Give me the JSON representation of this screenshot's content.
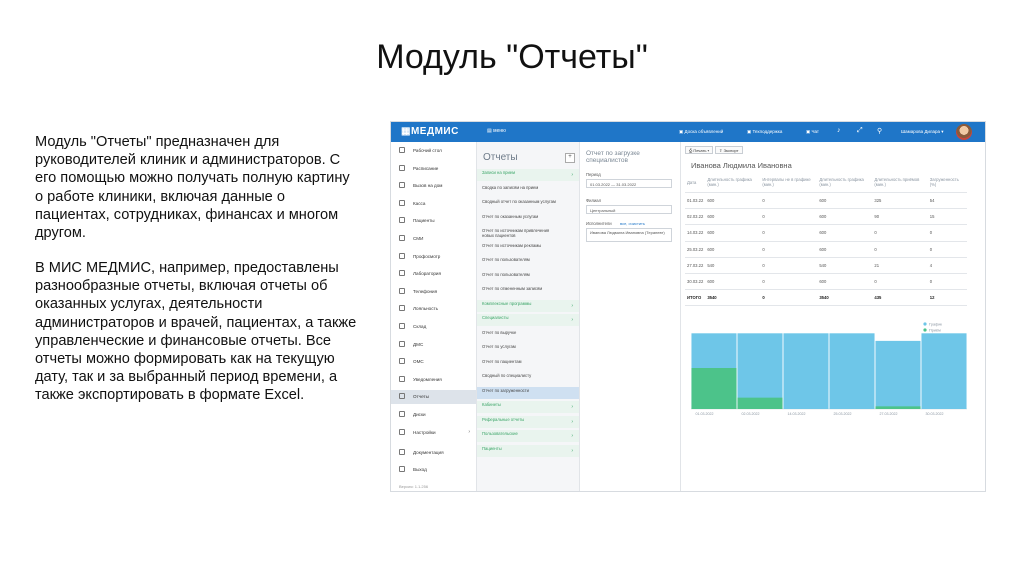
{
  "slide": {
    "title": "Модуль \"Отчеты\"",
    "paragraph1": "Модуль \"Отчеты\" предназначен для руководителей клиник и администраторов. С его помощью можно получать полную картину о работе клиники, включая данные о пациентах, сотрудниках, финансах и многом другом.",
    "paragraph2": "В МИС МЕДМИС, например, предоставлены разнообразные отчеты, включая отчеты об оказанных услугах, деятельности администраторов и врачей, пациентах, а также управленческие и финансовые отчеты. Все отчеты можно формировать как на текущую дату, так и за выбранный период времени, а также экспортировать в формате Excel."
  },
  "app": {
    "logo": "МЕДМИС",
    "menu_label": "меню",
    "topbar_items": [
      "Доска объявлений",
      "Техподдержка",
      "Чат"
    ],
    "user_name": "Шамарова Дилара",
    "accent_color": "#1f76c8",
    "sidebar": [
      {
        "label": "Рабочий стол",
        "icon": "desktop-icon"
      },
      {
        "label": "Расписание",
        "icon": "calendar-icon"
      },
      {
        "label": "Вызов на дом",
        "icon": "home-icon"
      },
      {
        "label": "Касса",
        "icon": "cash-icon"
      },
      {
        "label": "Пациенты",
        "icon": "patients-icon"
      },
      {
        "label": "СМИ",
        "icon": "media-icon"
      },
      {
        "label": "Профосмотр",
        "icon": "checkup-icon"
      },
      {
        "label": "Лаборатория",
        "icon": "lab-icon"
      },
      {
        "label": "Телефония",
        "icon": "phone-icon"
      },
      {
        "label": "Лояльность",
        "icon": "loyalty-icon"
      },
      {
        "label": "Склад",
        "icon": "warehouse-icon"
      },
      {
        "label": "ДМС",
        "icon": "insurance-icon"
      },
      {
        "label": "ОМС",
        "icon": "insurance-icon"
      },
      {
        "label": "Уведомления",
        "icon": "bell-icon"
      },
      {
        "label": "Отчеты",
        "icon": "reports-icon",
        "active": true
      },
      {
        "label": "Диски",
        "icon": "disk-icon"
      },
      {
        "label": "Настройки",
        "icon": "gear-icon"
      }
    ],
    "sidebar_bottom": [
      {
        "label": "Документация",
        "icon": "document-icon"
      },
      {
        "label": "Выход",
        "icon": "logout-icon"
      }
    ],
    "version": "Версия: 1.1.256",
    "reports_panel": {
      "title": "Отчеты",
      "items": [
        {
          "label": "Записи на прием",
          "group": true
        },
        {
          "label": "Сводка по записям на прием"
        },
        {
          "label": "Сводный отчет по оказанным услугам"
        },
        {
          "label": "Отчет по оказанным услугам"
        },
        {
          "label": "Отчет по источникам привлечения новых пациентов"
        },
        {
          "label": "Отчет по источникам рекламы"
        },
        {
          "label": "Отчет по пользователям"
        },
        {
          "label": "Отчет по пользователям"
        },
        {
          "label": "Отчет по отмененным записям"
        },
        {
          "label": "Комплексные программы",
          "group": true
        },
        {
          "label": "Специалисты",
          "group": true
        },
        {
          "label": "Отчет по выручке"
        },
        {
          "label": "Отчет по услугам"
        },
        {
          "label": "Отчет по пациентам"
        },
        {
          "label": "Сводный по специалисту"
        },
        {
          "label": "Отчет по загруженности",
          "active": true
        },
        {
          "label": "Кабинеты",
          "group": true
        },
        {
          "label": "Реферальные отчеты",
          "group": true
        },
        {
          "label": "Пользовательские",
          "group": true
        },
        {
          "label": "Пациенты",
          "group": true
        }
      ]
    },
    "filter_panel": {
      "title": "Отчет по загрузке специалистов",
      "period_label": "Период",
      "period_value": "01.03.2022 — 31.03.2022",
      "branch_label": "Филиал",
      "branch_value": "Центральный",
      "executor_label": "Исполнители",
      "executor_link": "все, очистить",
      "executor_value": "Иванова Людмила Ивановна (Терапевт)"
    },
    "main": {
      "print_button": "Печать",
      "export_button": "Экспорт",
      "doctor_name": "Иванова Людмила Ивановна",
      "table_headers": [
        "Дата",
        "Длительность графика (мин.)",
        "Интервалы не в графике (мин.)",
        "Длительность графика (мин.)",
        "Длительность приёмов (мин.)",
        "Загруженность (%)"
      ],
      "rows": [
        [
          "01.03.22",
          "600",
          "0",
          "600",
          "325",
          "54"
        ],
        [
          "02.03.22",
          "600",
          "0",
          "600",
          "90",
          "15"
        ],
        [
          "14.03.22",
          "600",
          "0",
          "600",
          "0",
          "0"
        ],
        [
          "25.03.22",
          "600",
          "0",
          "600",
          "0",
          "0"
        ],
        [
          "27.03.22",
          "540",
          "0",
          "540",
          "21",
          "4"
        ],
        [
          "30.03.22",
          "600",
          "0",
          "600",
          "0",
          "0"
        ]
      ],
      "total_row": [
        "ИТОГО",
        "3540",
        "0",
        "3540",
        "435",
        "12"
      ],
      "legend": [
        "График",
        "Приём"
      ],
      "chart_colors": {
        "schedule": "#6ec6e8",
        "appointment": "#4cc38a"
      },
      "chart_dates": [
        "01.03.2022",
        "02.03.2022",
        "14.03.2022",
        "25.03.2022",
        "27.03.2022",
        "30.03.2022"
      ],
      "schedule_values": [
        600,
        600,
        600,
        600,
        540,
        600
      ],
      "appointment_values": [
        325,
        90,
        0,
        0,
        21,
        0
      ],
      "y_max": 650
    }
  }
}
